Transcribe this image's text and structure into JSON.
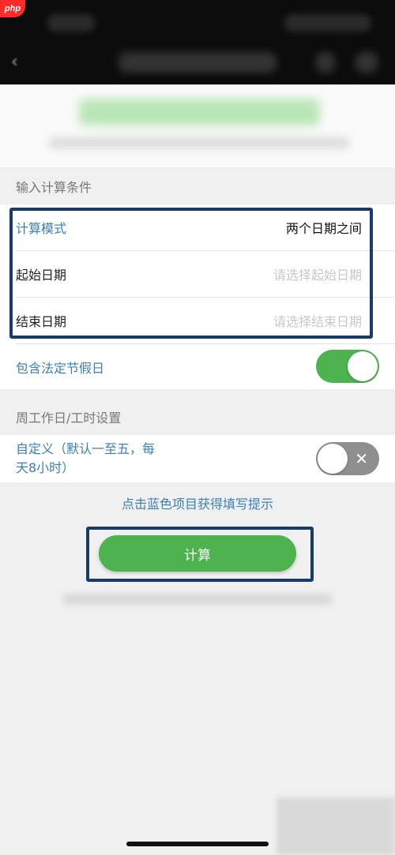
{
  "app": {
    "logo_text": "php"
  },
  "section1": {
    "title": "输入计算条件"
  },
  "form": {
    "mode": {
      "label": "计算模式",
      "value": "两个日期之间"
    },
    "start_date": {
      "label": "起始日期",
      "placeholder": "请选择起始日期"
    },
    "end_date": {
      "label": "结束日期",
      "placeholder": "请选择结束日期"
    },
    "holidays": {
      "label": "包含法定节假日",
      "toggle": "on"
    }
  },
  "section2": {
    "title": "周工作日/工时设置"
  },
  "custom": {
    "label_line1": "自定义（默认一至五，每",
    "label_line2": "天8小时）",
    "toggle": "off",
    "toggle_icon": "✕"
  },
  "hint": "点击蓝色项目获得填写提示",
  "calculate_button": "计算",
  "colors": {
    "accent_green": "#4cb34f",
    "link_blue": "#3b7fb6",
    "highlight_border": "#1a3a6b"
  }
}
